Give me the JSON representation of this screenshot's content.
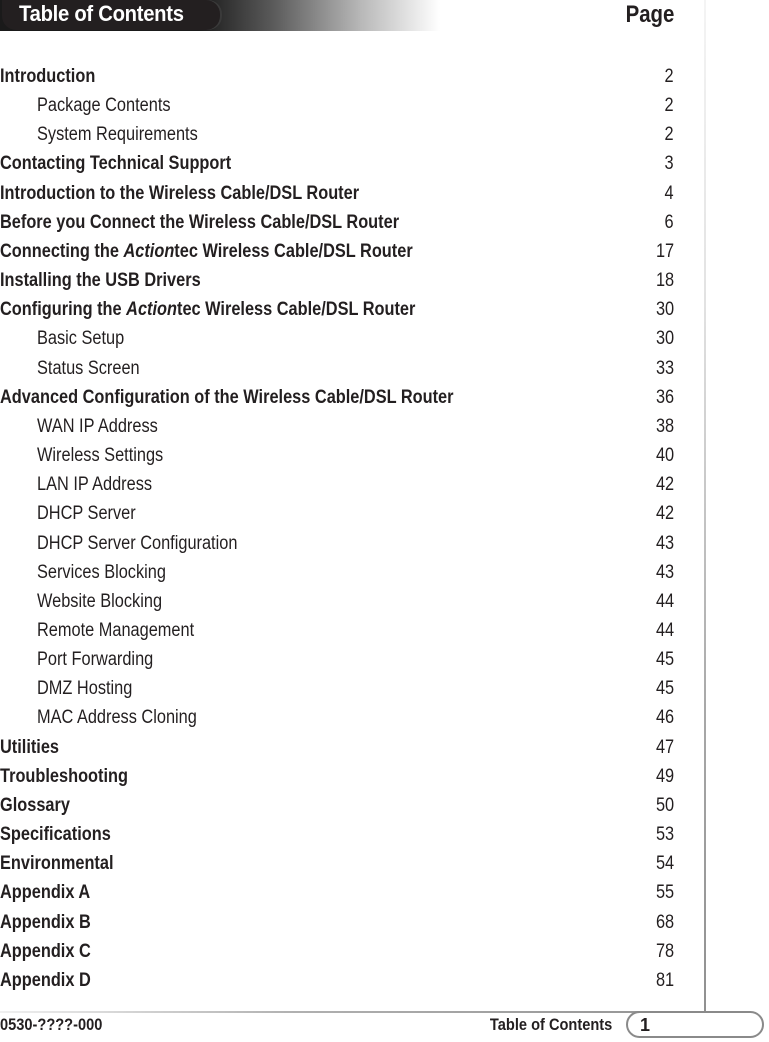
{
  "header": {
    "title": "Table of Contents",
    "page_column_label": "Page"
  },
  "toc": [
    {
      "level": "main",
      "label": "Introduction",
      "page": "2"
    },
    {
      "level": "sub",
      "label": "Package Contents",
      "page": "2"
    },
    {
      "level": "sub",
      "label": "System Requirements",
      "page": "2"
    },
    {
      "level": "main",
      "label": "Contacting Technical Support",
      "page": "3"
    },
    {
      "level": "main",
      "label": "Introduction to the Wireless Cable/DSL Router",
      "page": "4"
    },
    {
      "level": "main",
      "label": "Before you Connect the Wireless Cable/DSL Router",
      "page": "6"
    },
    {
      "level": "main",
      "label_pre": "Connecting the ",
      "label_brand": "Action",
      "label_post": "tec Wireless Cable/DSL Router",
      "page": "17"
    },
    {
      "level": "main",
      "label": "Installing the USB Drivers",
      "page": "18"
    },
    {
      "level": "main",
      "label_pre": "Configuring the ",
      "label_brand": "Action",
      "label_post": "tec Wireless Cable/DSL Router",
      "page": "30"
    },
    {
      "level": "sub",
      "label": "Basic Setup",
      "page": "30"
    },
    {
      "level": "sub",
      "label": "Status Screen",
      "page": "33"
    },
    {
      "level": "main",
      "label": "Advanced Configuration of the Wireless Cable/DSL Router",
      "page": "36"
    },
    {
      "level": "sub",
      "label": "WAN IP Address",
      "page": "38"
    },
    {
      "level": "sub",
      "label": "Wireless Settings",
      "page": "40"
    },
    {
      "level": "sub",
      "label": "LAN IP Address",
      "page": "42"
    },
    {
      "level": "sub",
      "label": "DHCP Server",
      "page": "42"
    },
    {
      "level": "sub",
      "label": "DHCP Server Configuration",
      "page": "43"
    },
    {
      "level": "sub",
      "label": "Services Blocking",
      "page": "43"
    },
    {
      "level": "sub",
      "label": "Website Blocking",
      "page": "44"
    },
    {
      "level": "sub",
      "label": "Remote Management",
      "page": "44"
    },
    {
      "level": "sub",
      "label": "Port Forwarding",
      "page": "45"
    },
    {
      "level": "sub",
      "label": "DMZ Hosting",
      "page": "45"
    },
    {
      "level": "sub",
      "label": "MAC Address Cloning",
      "page": "46"
    },
    {
      "level": "main",
      "label": "Utilities",
      "page": "47"
    },
    {
      "level": "main",
      "label": "Troubleshooting",
      "page": "49"
    },
    {
      "level": "main",
      "label": "Glossary",
      "page": "50"
    },
    {
      "level": "main",
      "label": "Specifications",
      "page": "53"
    },
    {
      "level": "main",
      "label": "Environmental",
      "page": "54"
    },
    {
      "level": "main",
      "label": "Appendix A",
      "page": "55"
    },
    {
      "level": "main",
      "label": "Appendix B",
      "page": "68"
    },
    {
      "level": "main",
      "label": "Appendix C",
      "page": "78"
    },
    {
      "level": "main",
      "label": "Appendix D",
      "page": "81"
    }
  ],
  "footer": {
    "doc_number": "0530-????-000",
    "section": "Table of Contents",
    "page_number": "1"
  }
}
